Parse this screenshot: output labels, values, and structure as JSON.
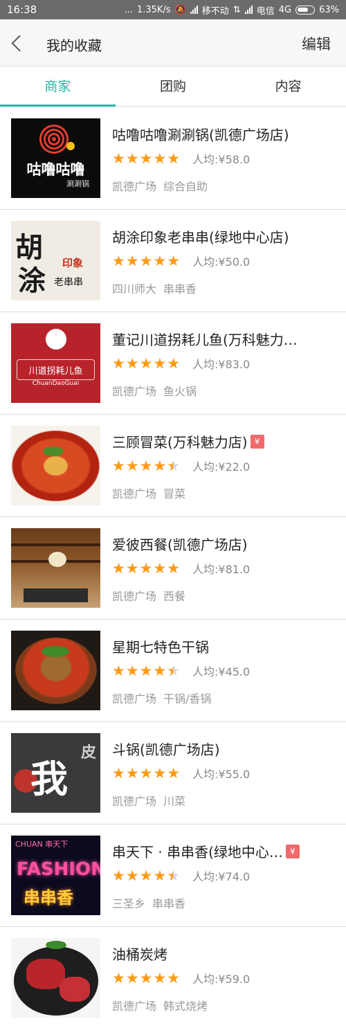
{
  "status_bar": {
    "time": "16:38",
    "dots": "...",
    "speed": "1.35K/s",
    "carrier1": "移不动",
    "carrier2": "电信",
    "network": "4G",
    "battery": "63%"
  },
  "header": {
    "title": "我的收藏",
    "edit_label": "编辑"
  },
  "tabs": [
    {
      "label": "商家",
      "active": true
    },
    {
      "label": "团购",
      "active": false
    },
    {
      "label": "内容",
      "active": false
    }
  ],
  "colors": {
    "accent": "#1fb8a6",
    "star": "#ff9a14",
    "badge": "#f06a6a"
  },
  "badge_label": "¥",
  "items": [
    {
      "name": "咕噜咕噜涮涮锅(凯德广场店)",
      "rating": 4.5,
      "avg_price": "人均:¥58.0",
      "area": "凯德广场",
      "category": "综合自助",
      "badge": false,
      "thumb": {
        "big": "咕噜咕噜",
        "small": "涮涮锅"
      }
    },
    {
      "name": "胡涂印象老串串(绿地中心店)",
      "rating": 4.5,
      "avg_price": "人均:¥50.0",
      "area": "四川师大",
      "category": "串串香",
      "badge": false,
      "thumb": {
        "c1": "胡",
        "c2": "涂",
        "seal": "印象",
        "sub": "老串串"
      }
    },
    {
      "name": "董记川道拐耗儿鱼(万科魅力…",
      "rating": 5,
      "avg_price": "人均:¥83.0",
      "area": "凯德广场",
      "category": "鱼火锅",
      "badge": false,
      "thumb": {
        "brand": "川道拐耗儿鱼",
        "eng": "ChuanDaoGuai"
      }
    },
    {
      "name": "三顾冒菜(万科魅力店)",
      "rating": 4,
      "avg_price": "人均:¥22.0",
      "area": "凯德广场",
      "category": "冒菜",
      "badge": true
    },
    {
      "name": "爱彼西餐(凯德广场店)",
      "rating": 5,
      "avg_price": "人均:¥81.0",
      "area": "凯德广场",
      "category": "西餐",
      "badge": false
    },
    {
      "name": "星期七特色干锅",
      "rating": 4,
      "avg_price": "人均:¥45.0",
      "area": "凯德广场",
      "category": "干锅/香锅",
      "badge": false
    },
    {
      "name": "斗锅(凯德广场店)",
      "rating": 4.5,
      "avg_price": "人均:¥55.0",
      "area": "凯德广场",
      "category": "川菜",
      "badge": false,
      "thumb": {
        "wo": "我",
        "txt": "皮"
      }
    },
    {
      "name": "串天下 · 串串香(绿地中心…",
      "rating": 4,
      "avg_price": "人均:¥74.0",
      "area": "三圣乡",
      "category": "串串香",
      "badge": true,
      "thumb": {
        "top": "CHUAN 串天下",
        "neon1": "FASHION",
        "neon2": "串串香"
      }
    },
    {
      "name": "油桶炭烤",
      "rating": 5,
      "avg_price": "人均:¥59.0",
      "area": "凯德广场",
      "category": "韩式烧烤",
      "badge": false
    }
  ]
}
